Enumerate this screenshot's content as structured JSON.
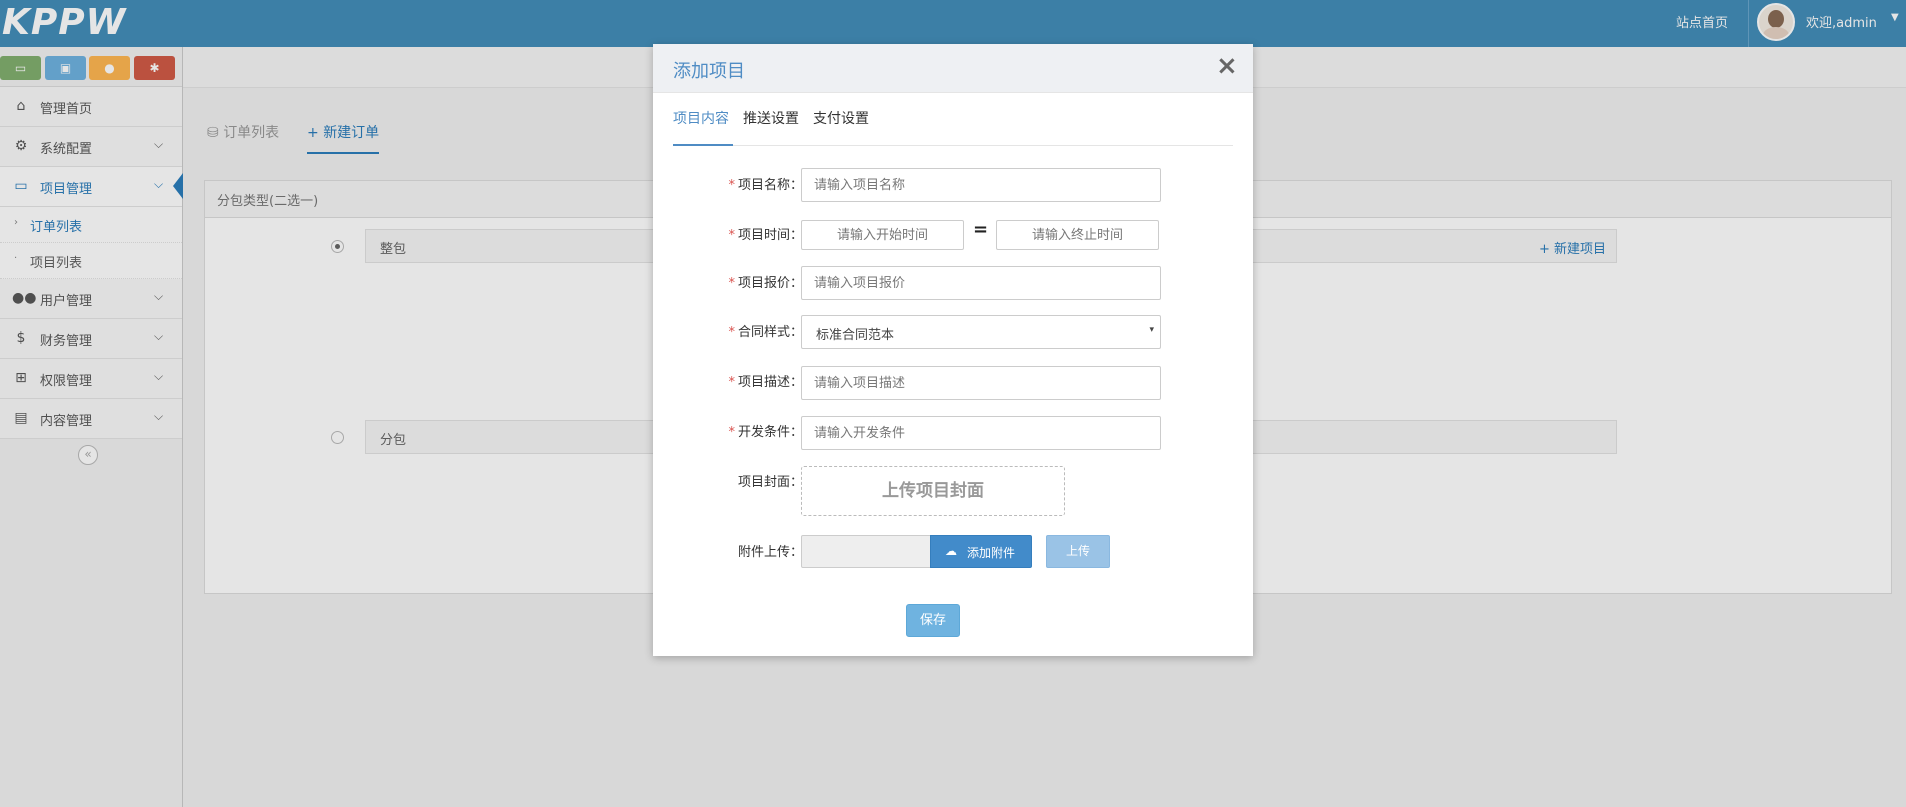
{
  "header": {
    "logo": "KPPW",
    "site_link": "站点首页",
    "welcome": "欢迎,admin",
    "caret_icon": "caret-down-icon"
  },
  "sidebar": {
    "shortcuts": [
      {
        "icon": "desktop-icon",
        "glyph": "▭",
        "color": "#82af6f"
      },
      {
        "icon": "picture-icon",
        "glyph": "▣",
        "color": "#6fb3e0"
      },
      {
        "icon": "user-icon",
        "glyph": "●",
        "color": "#ffb752"
      },
      {
        "icon": "cogs-icon",
        "glyph": "✱",
        "color": "#d15b47"
      }
    ],
    "items": [
      {
        "label": "管理首页",
        "icon": "home-icon",
        "glyph": "⌂"
      },
      {
        "label": "系统配置",
        "icon": "gear-icon",
        "glyph": "⚙",
        "arrow": "⌵"
      },
      {
        "label": "项目管理",
        "icon": "laptop-icon",
        "glyph": "▭",
        "arrow": "⌵"
      },
      {
        "label": "用户管理",
        "icon": "users-icon",
        "glyph": "👥",
        "arrow": "⌵"
      },
      {
        "label": "财务管理",
        "icon": "dollar-icon",
        "glyph": "$",
        "arrow": "⌵"
      },
      {
        "label": "权限管理",
        "icon": "sitemap-icon",
        "glyph": "⊞",
        "arrow": "⌵"
      },
      {
        "label": "内容管理",
        "icon": "news-icon",
        "glyph": "▤",
        "arrow": "⌵"
      }
    ],
    "subitems": [
      {
        "label": "订单列表"
      },
      {
        "label": "项目列表"
      }
    ],
    "collapse_glyph": "«"
  },
  "page": {
    "tabs": [
      {
        "label": "订单列表",
        "icon": "database-icon",
        "glyph": "⛁"
      },
      {
        "label": "新建订单",
        "icon": "plus-icon",
        "glyph": "+"
      }
    ],
    "panel_title": "分包类型(二选一)",
    "options": [
      {
        "label": "整包",
        "add_label": "+ 新建项目"
      },
      {
        "label": "分包"
      }
    ]
  },
  "modal": {
    "title": "添加项目",
    "close_glyph": "×",
    "tabs": [
      "项目内容",
      "推送设置",
      "支付设置"
    ],
    "fields": {
      "name": {
        "label": "项目名称：",
        "placeholder": "请输入项目名称"
      },
      "time": {
        "label": "项目时间：",
        "start_placeholder": "请输入开始时间",
        "end_placeholder": "请输入终止时间",
        "separator": "="
      },
      "price": {
        "label": "项目报价：",
        "placeholder": "请输入项目报价"
      },
      "contract": {
        "label": "合同样式：",
        "value": "标准合同范本",
        "caret": "▾"
      },
      "desc": {
        "label": "项目描述：",
        "placeholder": "请输入项目描述"
      },
      "dev": {
        "label": "开发条件：",
        "placeholder": "请输入开发条件"
      },
      "cover": {
        "label": "项目封面：",
        "button": "上传项目封面"
      },
      "attachment": {
        "label": "附件上传：",
        "add_button": "添加附件",
        "upload_button": "上传",
        "cloud_glyph": "☁"
      }
    },
    "required_mark": "*",
    "save_button": "保存"
  },
  "colors": {
    "topbar": "#438eb9",
    "accent": "#2b7dbc",
    "modal_accent": "#4f8cc4",
    "required": "#d9534f"
  }
}
